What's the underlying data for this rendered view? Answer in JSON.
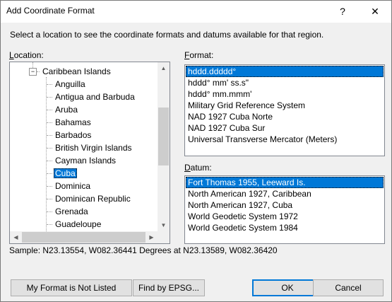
{
  "window": {
    "title": "Add Coordinate Format",
    "help_glyph": "?",
    "close_glyph": "✕"
  },
  "instructions": "Select a location to see the coordinate formats and datums available for that region.",
  "location": {
    "label_accel": "L",
    "label_rest": "ocation:",
    "parent": "Caribbean Islands",
    "items": [
      "Anguilla",
      "Antigua and Barbuda",
      "Aruba",
      "Bahamas",
      "Barbados",
      "British Virgin Islands",
      "Cayman Islands",
      "Cuba",
      "Dominica",
      "Dominican Republic",
      "Grenada",
      "Guadeloupe"
    ],
    "selected": "Cuba"
  },
  "format": {
    "label_accel": "F",
    "label_rest": "ormat:",
    "items": [
      "hddd.ddddd°",
      "hddd° mm' ss.s\"",
      "hddd° mm.mmm'",
      "Military Grid Reference System",
      "NAD 1927 Cuba Norte",
      "NAD 1927 Cuba Sur",
      "Universal Transverse Mercator (Meters)"
    ],
    "selected": "hddd.ddddd°"
  },
  "datum": {
    "label_accel": "D",
    "label_rest": "atum:",
    "items": [
      "Fort Thomas 1955, Leeward Is.",
      "North American 1927, Caribbean",
      "North American 1927, Cuba",
      "World Geodetic System 1972",
      "World Geodetic System 1984"
    ],
    "selected": "Fort Thomas 1955, Leeward Is."
  },
  "sample": "Sample: N23.13554, W082.36441 Degrees at N23.13589, W082.36420",
  "buttons": {
    "not_listed": "My Format is Not Listed",
    "epsg": "Find by EPSG...",
    "ok": "OK",
    "cancel": "Cancel"
  },
  "colors": {
    "selection": "#0078d7",
    "background": "#f0f0f0"
  }
}
